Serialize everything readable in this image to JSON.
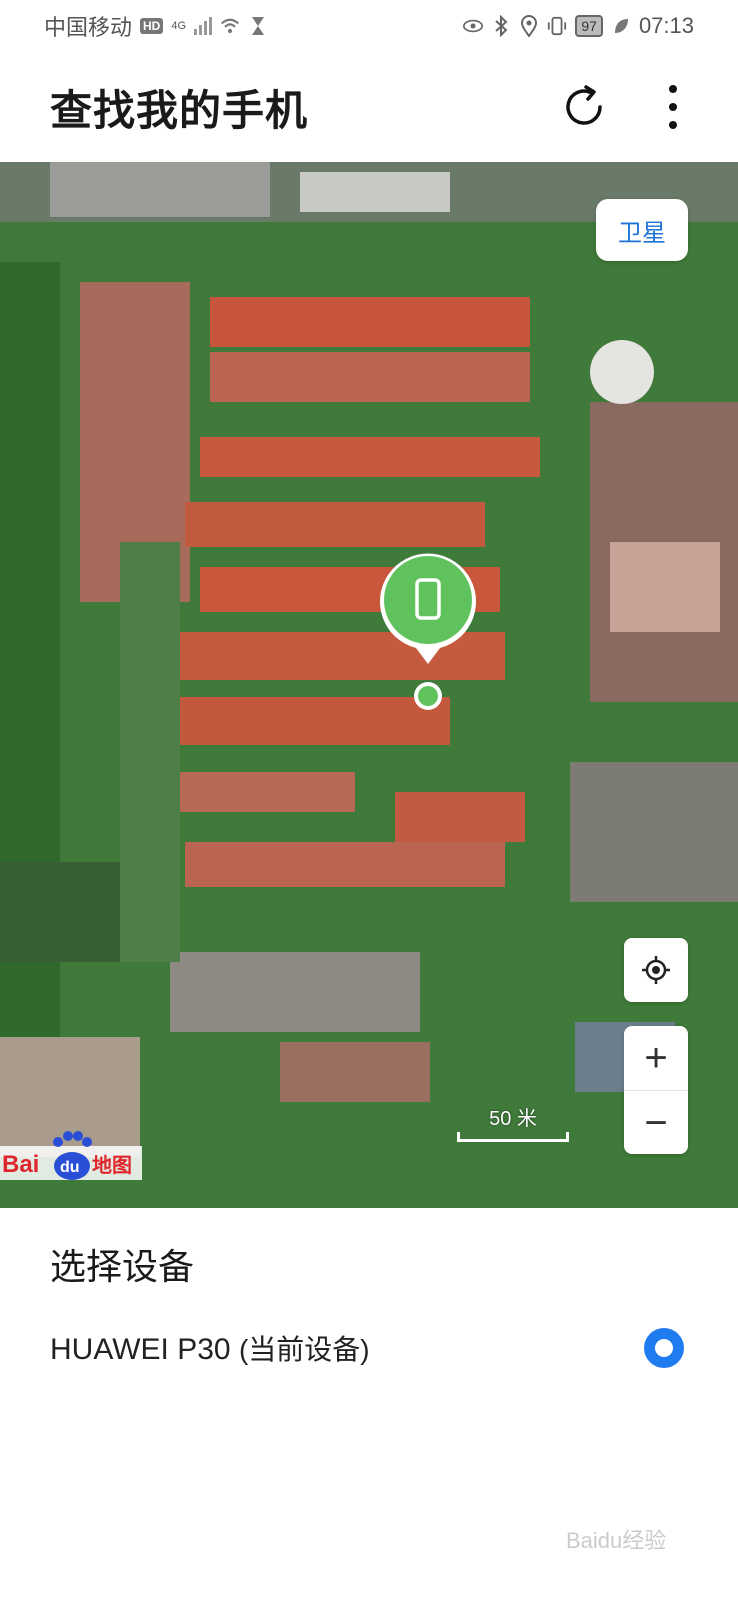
{
  "status_bar": {
    "carrier": "中国移动",
    "hd": "HD",
    "network": "4G",
    "battery": "97",
    "time": "07:13"
  },
  "header": {
    "title": "查找我的手机"
  },
  "map": {
    "satellite_toggle": "卫星",
    "scale_label": "50 米",
    "logo": "Bai地图",
    "zoom_in": "+",
    "zoom_out": "−"
  },
  "panel": {
    "title": "选择设备",
    "devices": [
      {
        "name": "HUAWEI P30",
        "note": "(当前设备)",
        "selected": true
      }
    ]
  },
  "watermark": "Baidu经验",
  "icons": {
    "refresh": "refresh-icon",
    "more": "more-vertical-icon",
    "locate": "locate-icon",
    "marker": "phone-marker-icon"
  },
  "colors": {
    "accent": "#1e7cf0",
    "marker_green": "#5fc25c",
    "satellite_text": "#1e73d6"
  }
}
